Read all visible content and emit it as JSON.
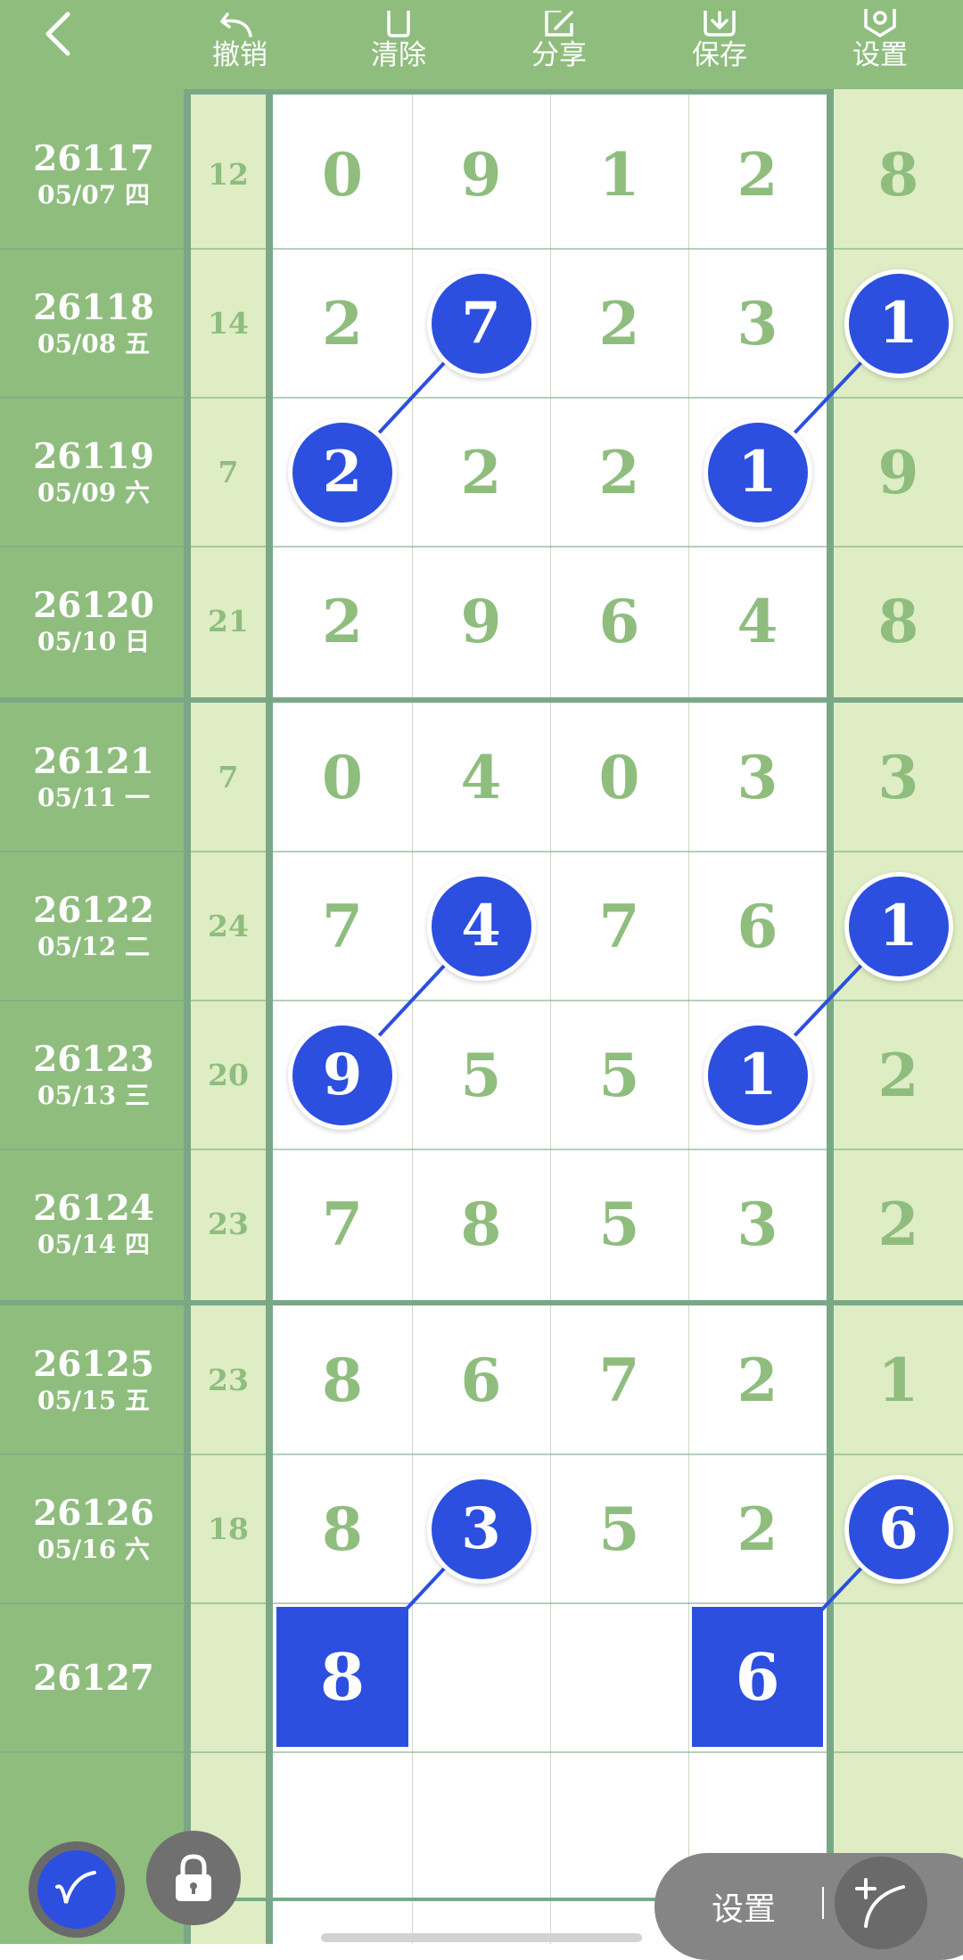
{
  "toolbar": {
    "back_icon": "chevron-left-icon",
    "tools": [
      {
        "label": "撤销",
        "icon": "undo-icon"
      },
      {
        "label": "清除",
        "icon": "clear-icon"
      },
      {
        "label": "分享",
        "icon": "share-icon"
      },
      {
        "label": "保存",
        "icon": "save-icon"
      },
      {
        "label": "设置",
        "icon": "settings-icon"
      }
    ]
  },
  "colors": {
    "header_green": "#8fbd7e",
    "light_green": "#deedc4",
    "digit_green": "#8fbd7e",
    "marker_blue": "#2c4fe0",
    "grid_line": "#7aa887"
  },
  "rows": [
    {
      "issue": "26117",
      "date": "05/07 四",
      "sum": "12",
      "digits": [
        "0",
        "9",
        "1",
        "2",
        "8"
      ]
    },
    {
      "issue": "26118",
      "date": "05/08 五",
      "sum": "14",
      "digits": [
        "2",
        "7",
        "2",
        "3",
        "1"
      ]
    },
    {
      "issue": "26119",
      "date": "05/09 六",
      "sum": "7",
      "digits": [
        "2",
        "2",
        "2",
        "1",
        "9"
      ]
    },
    {
      "issue": "26120",
      "date": "05/10 日",
      "sum": "21",
      "digits": [
        "2",
        "9",
        "6",
        "4",
        "8"
      ]
    },
    {
      "issue": "26121",
      "date": "05/11 一",
      "sum": "7",
      "digits": [
        "0",
        "4",
        "0",
        "3",
        "3"
      ]
    },
    {
      "issue": "26122",
      "date": "05/12 二",
      "sum": "24",
      "digits": [
        "7",
        "4",
        "7",
        "6",
        "1"
      ]
    },
    {
      "issue": "26123",
      "date": "05/13 三",
      "sum": "20",
      "digits": [
        "9",
        "5",
        "5",
        "1",
        "2"
      ]
    },
    {
      "issue": "26124",
      "date": "05/14 四",
      "sum": "23",
      "digits": [
        "7",
        "8",
        "5",
        "3",
        "2"
      ]
    },
    {
      "issue": "26125",
      "date": "05/15 五",
      "sum": "23",
      "digits": [
        "8",
        "6",
        "7",
        "2",
        "1"
      ]
    },
    {
      "issue": "26126",
      "date": "05/16 六",
      "sum": "18",
      "digits": [
        "8",
        "3",
        "5",
        "2",
        "6"
      ]
    },
    {
      "issue": "26127",
      "date": "",
      "sum": "",
      "digits": [
        "",
        "",
        "",
        "",
        ""
      ]
    }
  ],
  "highlights": [
    {
      "row": 1,
      "col": 1
    },
    {
      "row": 1,
      "col": 4
    },
    {
      "row": 2,
      "col": 0
    },
    {
      "row": 2,
      "col": 3
    },
    {
      "row": 5,
      "col": 1
    },
    {
      "row": 5,
      "col": 4
    },
    {
      "row": 6,
      "col": 0
    },
    {
      "row": 6,
      "col": 3
    },
    {
      "row": 9,
      "col": 1
    },
    {
      "row": 9,
      "col": 4
    }
  ],
  "connectors": [
    {
      "from": {
        "row": 1,
        "col": 1
      },
      "to": {
        "row": 2,
        "col": 0
      }
    },
    {
      "from": {
        "row": 1,
        "col": 4
      },
      "to": {
        "row": 2,
        "col": 3
      }
    },
    {
      "from": {
        "row": 5,
        "col": 1
      },
      "to": {
        "row": 6,
        "col": 0
      }
    },
    {
      "from": {
        "row": 5,
        "col": 4
      },
      "to": {
        "row": 6,
        "col": 3
      }
    },
    {
      "from": {
        "row": 9,
        "col": 1
      },
      "to": {
        "row": 10,
        "col": 0
      }
    },
    {
      "from": {
        "row": 9,
        "col": 4
      },
      "to": {
        "row": 10,
        "col": 3
      }
    }
  ],
  "picks": [
    {
      "row": 10,
      "col": 0,
      "value": "8"
    },
    {
      "row": 10,
      "col": 3,
      "value": "6"
    }
  ],
  "bottom_controls": {
    "pen_icon": "pen-icon",
    "lock_icon": "lock-icon",
    "settings_label": "设置",
    "draw_icon": "draw-line-icon"
  }
}
